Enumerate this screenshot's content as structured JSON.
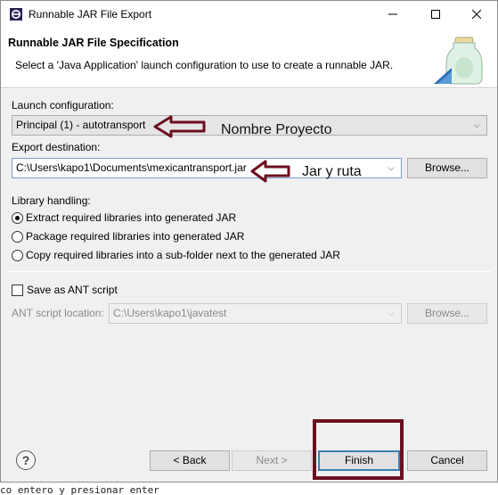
{
  "window": {
    "title": "Runnable JAR File Export",
    "minimize_icon": "minimize-icon",
    "maximize_icon": "maximize-icon",
    "close_icon": "close-icon"
  },
  "banner": {
    "title": "Runnable JAR File Specification",
    "description": "Select a 'Java Application' launch configuration to use to create a runnable JAR."
  },
  "launch": {
    "label": "Launch configuration:",
    "value": "Principal (1) - autotransport"
  },
  "export": {
    "label": "Export destination:",
    "value": "C:\\Users\\kapo1\\Documents\\mexicantransport.jar",
    "browse_label": "Browse..."
  },
  "library": {
    "label": "Library handling:",
    "options": [
      {
        "label": "Extract required libraries into generated JAR",
        "selected": true
      },
      {
        "label": "Package required libraries into generated JAR",
        "selected": false
      },
      {
        "label": "Copy required libraries into a sub-folder next to the generated JAR",
        "selected": false
      }
    ]
  },
  "ant": {
    "checkbox_label": "Save as ANT script",
    "checked": false,
    "location_label": "ANT script location:",
    "location_value": "C:\\Users\\kapo1\\javatest",
    "browse_label": "Browse..."
  },
  "footer": {
    "help": "?",
    "back_label": "< Back",
    "next_label": "Next >",
    "finish_label": "Finish",
    "cancel_label": "Cancel"
  },
  "annotations": {
    "project_note": "Nombre Proyecto",
    "jar_note": "Jar y ruta",
    "arrow_color": "#6b1020",
    "highlight_color": "#6b1020"
  },
  "background_text": "co entero y presionar enter"
}
